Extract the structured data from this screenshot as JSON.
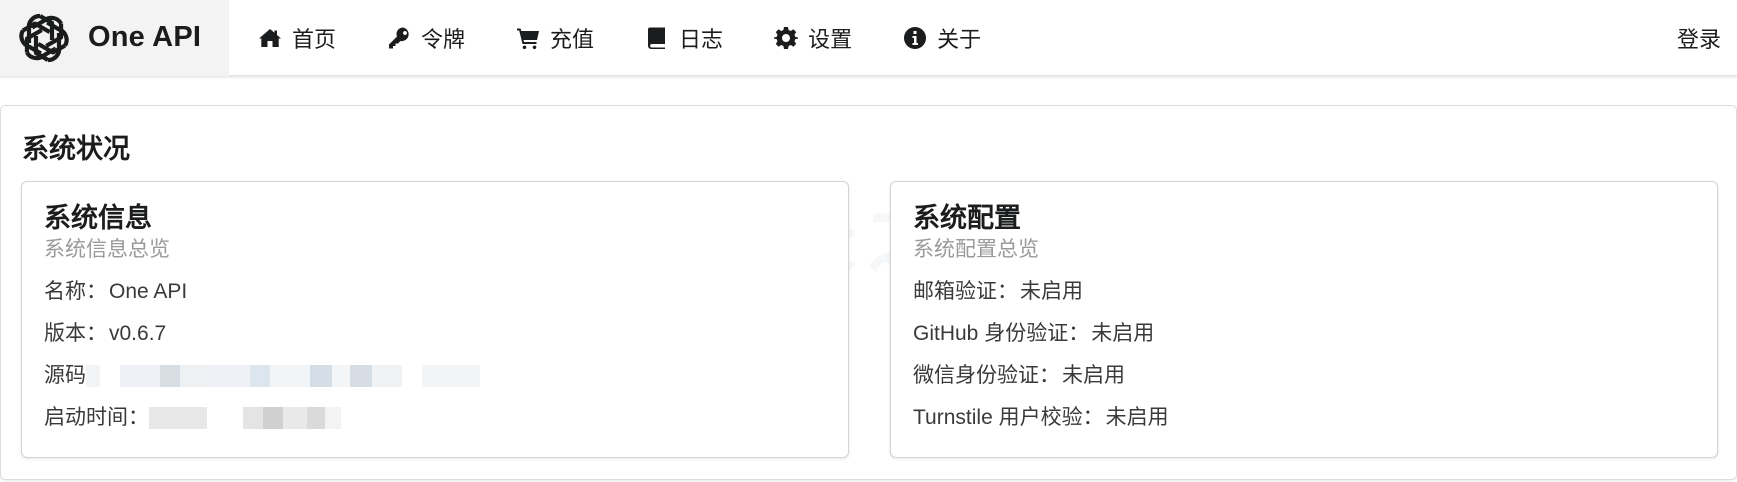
{
  "navbar": {
    "brand": "One API",
    "items": [
      {
        "icon": "home-icon",
        "label": "首页"
      },
      {
        "icon": "key-icon",
        "label": "令牌"
      },
      {
        "icon": "cart-icon",
        "label": "充值"
      },
      {
        "icon": "book-icon",
        "label": "日志"
      },
      {
        "icon": "gear-icon",
        "label": "设置"
      },
      {
        "icon": "info-icon",
        "label": "关于"
      }
    ],
    "login": "登录"
  },
  "page": {
    "title": "系统状况",
    "watermark": "站长之家"
  },
  "system_info": {
    "header": "系统信息",
    "meta": "系统信息总览",
    "name_label": "名称：",
    "name_value": "One API",
    "version_label": "版本：",
    "version_value": "v0.6.7",
    "source_label": "源码",
    "startup_label": "启动时间："
  },
  "system_config": {
    "header": "系统配置",
    "meta": "系统配置总览",
    "email_label": "邮箱验证：",
    "email_value": "未启用",
    "github_label": "GitHub 身份验证：",
    "github_value": "未启用",
    "wechat_label": "微信身份验证：",
    "wechat_value": "未启用",
    "turnstile_label": "Turnstile 用户校验：",
    "turnstile_value": "未启用"
  }
}
